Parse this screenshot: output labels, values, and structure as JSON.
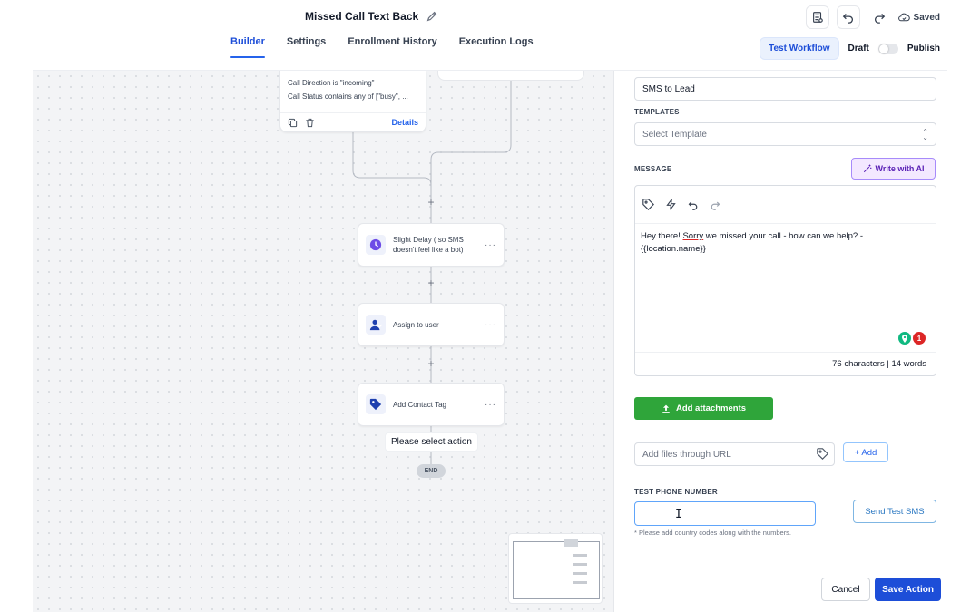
{
  "header": {
    "title": "Missed Call Text Back",
    "saved_label": "Saved",
    "tabs": [
      {
        "label": "Builder",
        "active": true
      },
      {
        "label": "Settings",
        "active": false
      },
      {
        "label": "Enrollment History",
        "active": false
      },
      {
        "label": "Execution Logs",
        "active": false
      }
    ],
    "test_workflow_label": "Test Workflow",
    "draft_label": "Draft",
    "publish_label": "Publish"
  },
  "canvas": {
    "condition_card": {
      "line1": "Call Direction is \"incoming\"",
      "line2": "Call Status contains any of [\"busy\", ...",
      "details_label": "Details"
    },
    "nodes": [
      {
        "label": "Slight Delay ( so SMS doesn't feel like a bot)",
        "icon": "clock-icon"
      },
      {
        "label": "Assign to user",
        "icon": "user-assign-icon"
      },
      {
        "label": "Add Contact Tag",
        "icon": "tag-icon"
      }
    ],
    "select_action_label": "Please select action",
    "end_label": "END"
  },
  "panel": {
    "action_name_value": "SMS to Lead",
    "templates_label": "TEMPLATES",
    "template_placeholder": "Select Template",
    "message_label": "MESSAGE",
    "write_ai_label": "Write with AI",
    "message_text_prefix": "Hey there! ",
    "message_text_sorry": "Sorry",
    "message_text_rest": " we missed your call - how can we help? - {{location.name}}",
    "count_text": "76 characters | 14 words",
    "notification_count": "1",
    "add_attachments_label": "Add attachments",
    "url_placeholder": "Add files through URL",
    "add_label": "+ Add",
    "test_phone_label": "TEST PHONE NUMBER",
    "test_phone_value": "",
    "send_test_label": "Send Test SMS",
    "help_text": "* Please add country codes along with the numbers.",
    "cancel_label": "Cancel",
    "save_label": "Save Action"
  },
  "colors": {
    "primary": "#1d4ed8",
    "attach_green": "#2fa53a",
    "ai_purple": "#5b21b6"
  }
}
